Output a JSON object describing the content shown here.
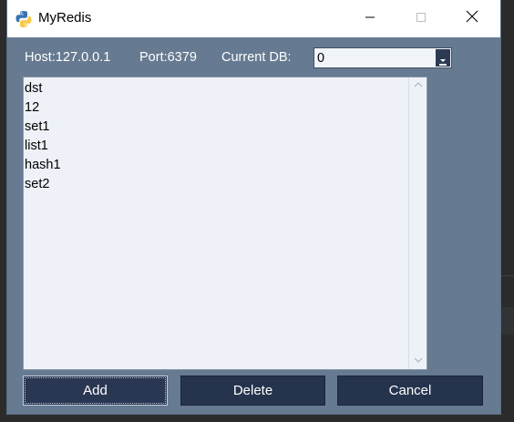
{
  "window": {
    "title": "MyRedis"
  },
  "info": {
    "host": "Host:127.0.0.1",
    "port": "Port:6379",
    "current_db_label": "Current DB:"
  },
  "db_select": {
    "value": "0"
  },
  "keys_list": {
    "items": [
      "dst",
      "12",
      "set1",
      "list1",
      "hash1",
      "set2"
    ]
  },
  "buttons": {
    "add": "Add",
    "delete": "Delete",
    "cancel": "Cancel"
  },
  "colors": {
    "window_bg": "#667a91",
    "button_bg": "#26334d",
    "list_bg": "#eef2f8"
  },
  "icons": {
    "app": "python-icon",
    "minimize": "minimize-icon",
    "maximize": "maximize-icon",
    "close": "close-icon",
    "dropdown": "chevron-down-icon",
    "scroll_up": "scroll-up-icon",
    "scroll_down": "scroll-down-icon"
  }
}
